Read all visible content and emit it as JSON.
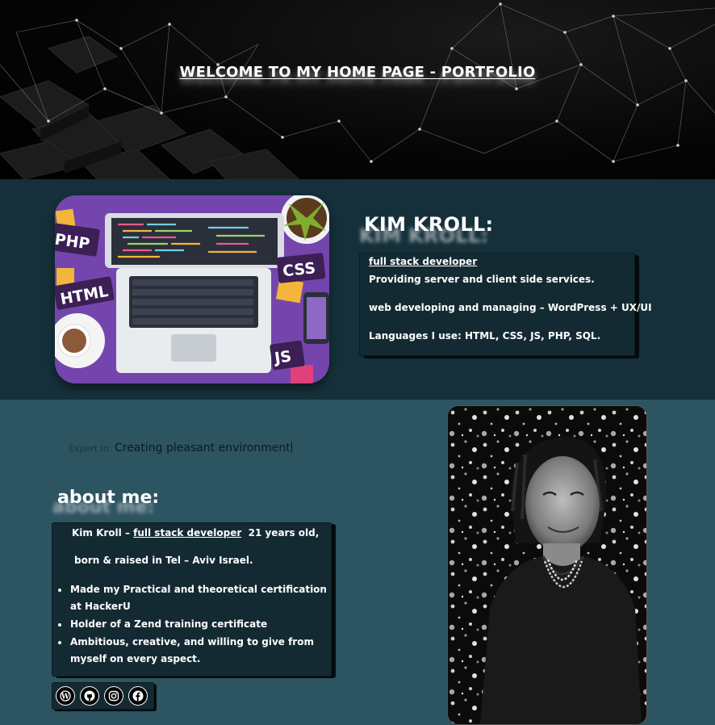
{
  "hero": {
    "title": "WELCOME TO MY HOME PAGE - PORTFOLIO"
  },
  "intro": {
    "name": "KIM KROLL:",
    "role_link": "full stack developer",
    "line1": "Providing server and client side services.",
    "line2": "web developing and managing – WordPress +  UX/UI",
    "line3": "Languages I use: HTML, CSS, JS, PHP, SQL.",
    "illustration_labels": [
      "PHP",
      "HTML",
      "CSS",
      "JS"
    ]
  },
  "expert": {
    "label": "Expert In:",
    "value": "Creating pleasant environment"
  },
  "about": {
    "heading": "about me:",
    "intro_prefix": "Kim Kroll – ",
    "intro_link": "full stack developer",
    "intro_suffix": "  21 years old,",
    "born": "born & raised in Tel – Aviv Israel.",
    "bullets": [
      "Made my Practical and theoretical certification at HackerU",
      "Holder of a Zend training certificate",
      "Ambitious, creative, and willing to give from myself on every aspect."
    ]
  },
  "social": [
    {
      "icon": "wordpress-icon"
    },
    {
      "icon": "github-icon"
    },
    {
      "icon": "instagram-icon"
    },
    {
      "icon": "facebook-icon"
    }
  ],
  "colors": {
    "hero_bg": "#000000",
    "section1_bg": "#15303a",
    "section2_bg": "#2d5461",
    "box_bg": "#142a33"
  }
}
